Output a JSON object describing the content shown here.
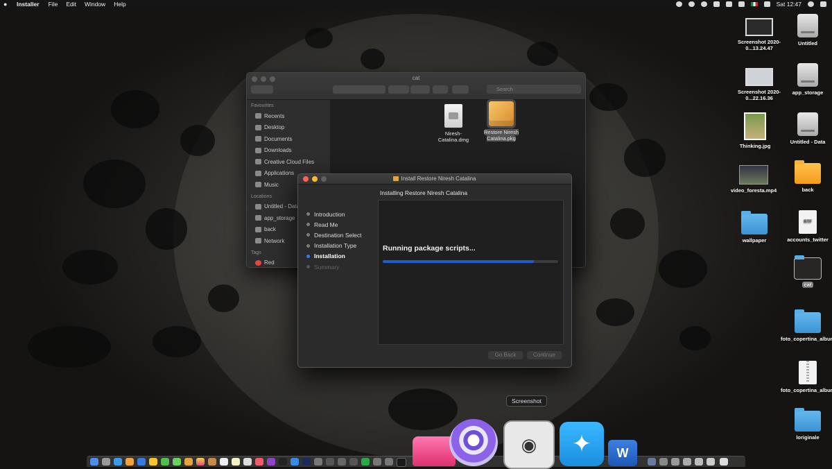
{
  "menubar": {
    "app_name": "Installer",
    "menus": [
      "File",
      "Edit",
      "Window",
      "Help"
    ],
    "clock": "Sat 12:47"
  },
  "desktop": {
    "items": [
      {
        "label": "Screenshot 2020-0...13.24.47",
        "kind": "screenshot"
      },
      {
        "label": "Untitled",
        "kind": "disk"
      },
      {
        "label": "Screenshot 2020-0...22.16.36",
        "kind": "screenshot"
      },
      {
        "label": "app_storage",
        "kind": "disk"
      },
      {
        "label": "Thinking.jpg",
        "kind": "photo"
      },
      {
        "label": "Untitled - Data",
        "kind": "disk"
      },
      {
        "label": "video_foresta.mp4",
        "kind": "video"
      },
      {
        "label": "back",
        "kind": "folder-orange"
      },
      {
        "label": "wallpaper",
        "kind": "folder"
      },
      {
        "label": "accounts_twitter",
        "kind": "rtf"
      },
      {
        "label": "cat",
        "kind": "folder"
      },
      {
        "label": "foto_copertina_album",
        "kind": "folder"
      },
      {
        "label": "foto_copertina_album.zip",
        "kind": "zip"
      },
      {
        "label": "loriginale",
        "kind": "folder"
      }
    ],
    "rtf_badge": "RTF"
  },
  "finder": {
    "title": "cat",
    "search_placeholder": "Search",
    "favourites_header": "Favourites",
    "favourites": [
      "Recents",
      "Desktop",
      "Documents",
      "Downloads",
      "Creative Cloud Files",
      "Applications",
      "Music"
    ],
    "locations_header": "Locations",
    "locations": [
      "Untitled - Data",
      "app_storage",
      "back",
      "Network"
    ],
    "tags_header": "Tags",
    "tags": [
      "Red"
    ],
    "files": [
      {
        "name": "Niresh-Catalina.dmg",
        "icon": "dmg-icon"
      },
      {
        "name": "Restore Niresh Catalina.pkg",
        "icon": "package-icon"
      }
    ]
  },
  "installer": {
    "title": "Install Restore Niresh Catalina",
    "heading": "Installing Restore Niresh Catalina",
    "steps": [
      {
        "label": "Introduction",
        "state": "done"
      },
      {
        "label": "Read Me",
        "state": "done"
      },
      {
        "label": "Destination Select",
        "state": "done"
      },
      {
        "label": "Installation Type",
        "state": "done"
      },
      {
        "label": "Installation",
        "state": "current"
      },
      {
        "label": "Summary",
        "state": "pending"
      }
    ],
    "status": "Running package scripts...",
    "progress": 0.86,
    "go_back_label": "Go Back",
    "continue_label": "Continue"
  },
  "dock": {
    "tooltip": "Screenshot"
  },
  "colors": {
    "accent": "#1e5fcf",
    "close": "#fe5f57",
    "minimize": "#febc2e"
  }
}
